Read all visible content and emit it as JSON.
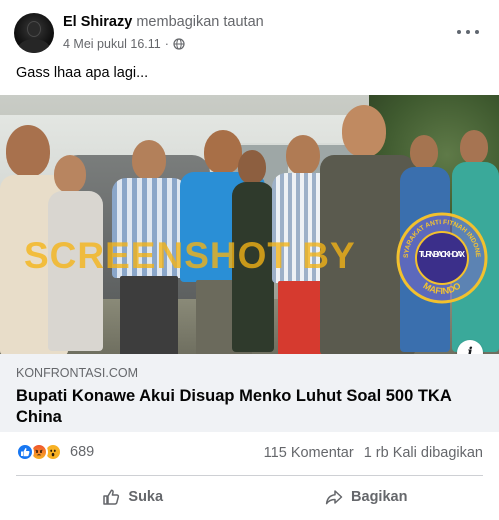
{
  "post": {
    "author_name": "El Shirazy",
    "author_action": "membagikan tautan",
    "timestamp": "4 Mei pukul 16.11",
    "separator": "·",
    "privacy_icon": "globe-icon",
    "caption": "Gass lhaa apa lagi..."
  },
  "link": {
    "image_watermark": "SCREENSHOT BY",
    "seal_text_top": "MASYARAKAT ANTI FITNAH INDONESIA",
    "seal_text_center": "TURN BACK HOAX",
    "seal_text_bottom": "MAFINDO",
    "info_label": "i",
    "domain": "KONFRONTASI.COM",
    "title": "Bupati Konawe Akui Disuap Menko Luhut Soal 500 TKA China"
  },
  "engagement": {
    "reactions": [
      "like-icon",
      "angry-icon",
      "wow-icon"
    ],
    "reaction_count": "689",
    "comments": "115 Komentar",
    "shares": "1 rb Kali dibagikan"
  },
  "actions": {
    "like_label": "Suka",
    "share_label": "Bagikan"
  },
  "colors": {
    "accent": "#1877f2",
    "secondary_text": "#65676b",
    "link_bg": "#f0f2f5",
    "watermark": "#f5b414"
  }
}
